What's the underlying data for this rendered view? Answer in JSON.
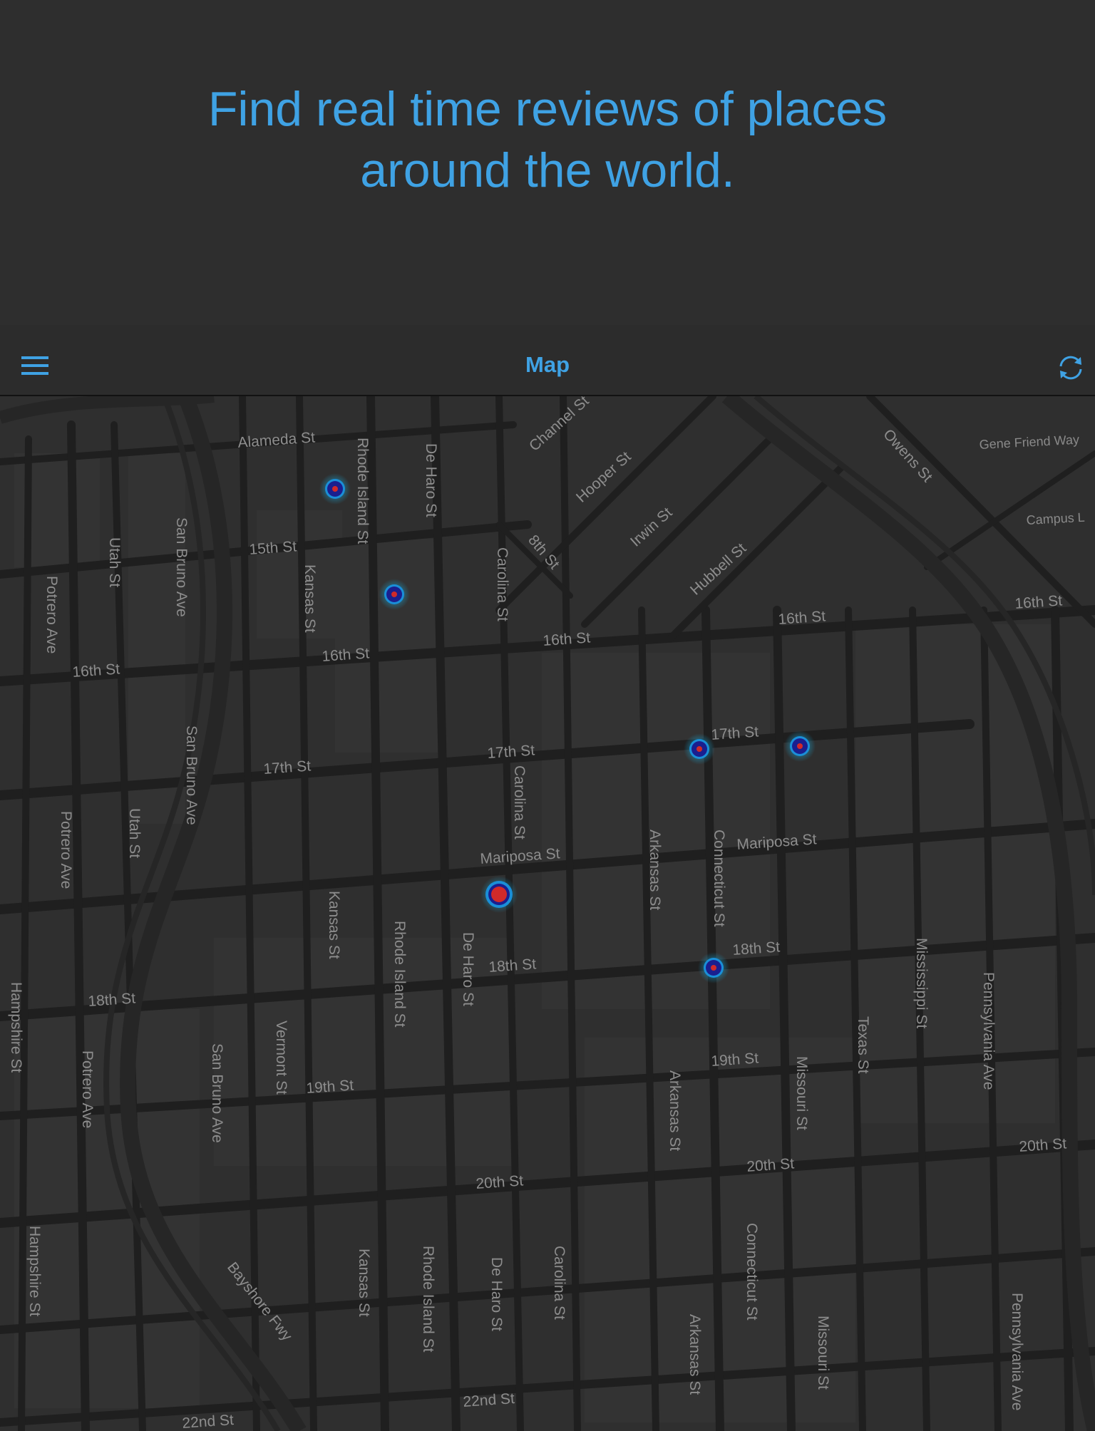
{
  "promo": {
    "text_line1": "Find real time reviews of places",
    "text_line2": "around the world."
  },
  "navbar": {
    "title": "Map",
    "menu_icon": "hamburger-menu-icon",
    "refresh_icon": "refresh-icon"
  },
  "colors": {
    "accent": "#3fa2e4",
    "background": "#2e2e2e",
    "pin_ring": "#1aa9d8",
    "pin_core": "#d02a2a"
  },
  "map": {
    "streets": {
      "alameda": "Alameda St",
      "rhode_island_1": "Rhode Island St",
      "de_haro_1": "De Haro St",
      "channel": "Channel St",
      "hooper": "Hooper St",
      "owens": "Owens St",
      "gene_friend": "Gene Friend Way",
      "campus": "Campus L",
      "irwin": "Irwin St",
      "hubbell": "Hubbell St",
      "eighth": "8th St",
      "carolina_1": "Carolina St",
      "utah_1": "Utah St",
      "san_bruno_1": "San Bruno Ave",
      "fifteenth": "15th St",
      "kansas_1": "Kansas St",
      "potrero_1": "Potrero Ave",
      "sixteenth_1": "16th St",
      "sixteenth_2": "16th St",
      "sixteenth_3": "16th St",
      "sixteenth_4": "16th St",
      "sixteenth_5": "16th St",
      "san_bruno_2": "San Bruno Ave",
      "seventeenth_1": "17th St",
      "seventeenth_2": "17th St",
      "seventeenth_3": "17th St",
      "carolina_2": "Carolina St",
      "potrero_2": "Potrero Ave",
      "utah_2": "Utah St",
      "mariposa_1": "Mariposa St",
      "mariposa_2": "Mariposa St",
      "arkansas_1": "Arkansas St",
      "connecticut_1": "Connecticut St",
      "kansas_2": "Kansas St",
      "rhode_island_2": "Rhode Island St",
      "de_haro_2": "De Haro St",
      "eighteenth_1": "18th St",
      "eighteenth_2": "18th St",
      "eighteenth_3": "18th St",
      "mississippi": "Mississippi St",
      "pennsylvania_1": "Pennsylvania Ave",
      "texas": "Texas St",
      "hampshire_1": "Hampshire St",
      "potrero_3": "Potrero Ave",
      "san_bruno_3": "San Bruno Ave",
      "vermont": "Vermont St",
      "nineteenth_1": "19th St",
      "nineteenth_2": "19th St",
      "arkansas_2": "Arkansas St",
      "missouri_1": "Missouri St",
      "twentieth_1": "20th St",
      "twentieth_2": "20th St",
      "twentieth_3": "20th St",
      "hampshire_2": "Hampshire St",
      "kansas_3": "Kansas St",
      "rhode_island_3": "Rhode Island St",
      "de_haro_3": "De Haro St",
      "carolina_3": "Carolina St",
      "connecticut_2": "Connecticut St",
      "arkansas_3": "Arkansas St",
      "missouri_2": "Missouri St",
      "pennsylvania_2": "Pennsylvania Ave",
      "bayshore": "Bayshore Fwy",
      "twentysecond_1": "22nd St",
      "twentysecond_2": "22nd St"
    }
  }
}
